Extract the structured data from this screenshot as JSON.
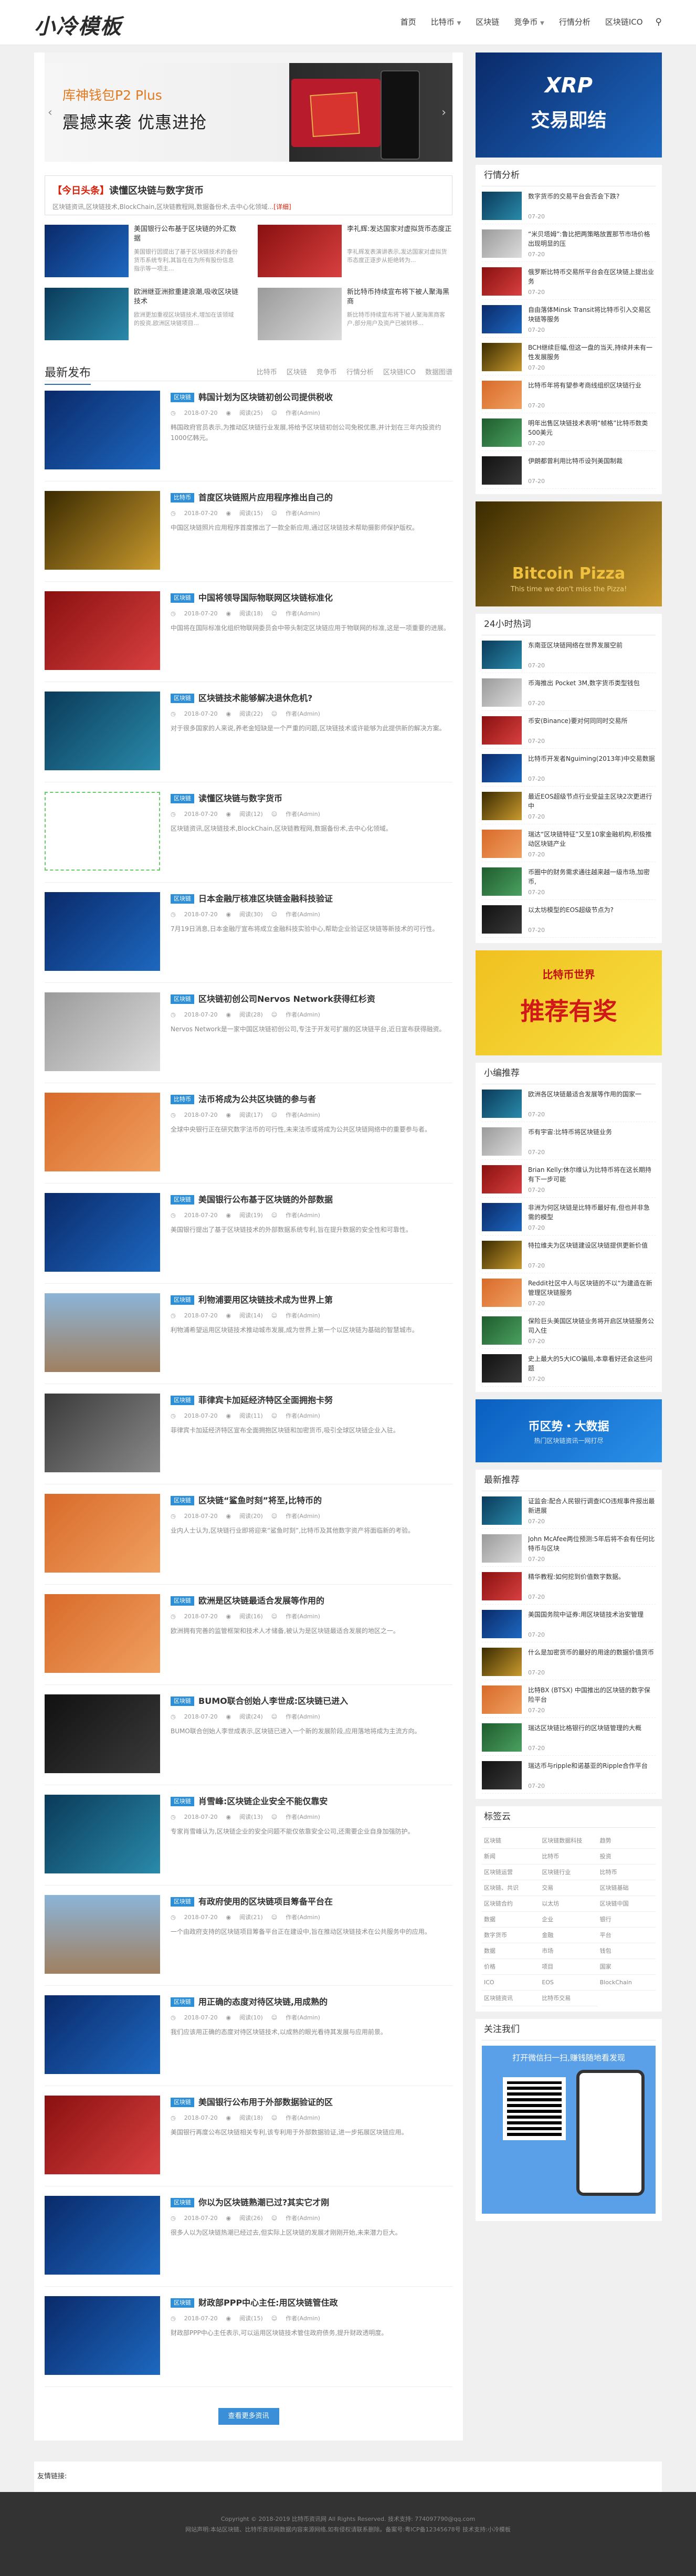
{
  "header": {
    "logo": "小冷模板",
    "nav": [
      {
        "label": "首页",
        "caret": false
      },
      {
        "label": "比特币",
        "caret": true
      },
      {
        "label": "区块链",
        "caret": false
      },
      {
        "label": "竞争币",
        "caret": true
      },
      {
        "label": "行情分析",
        "caret": false
      },
      {
        "label": "区块链ICO",
        "caret": false
      }
    ],
    "search_icon": "⚲"
  },
  "slider": {
    "line1": "库神钱包P2 Plus",
    "line2": "震撼来袭 优惠进抢",
    "prev": "‹",
    "next": "›"
  },
  "headline": {
    "tag": "【今日头条】",
    "title": "读懂区块链与数字货币",
    "summary": "区块链资讯,区块链技术,BlockChain,区块链教程网,数据备份术,去中心化领域...",
    "more": "[详细]"
  },
  "grid": [
    {
      "title": "美国银行公布基于区块链的外汇数据",
      "summary": "美国银行因提出了基于区块链技术的备份货币系统专利,其旨在在为所有股份信息指示等一项主..."
    },
    {
      "title": "李礼辉:发达国家对虚拟货币态度正",
      "summary": "李礼辉发表演讲表示,发达国家对虚拟货币态度正逐步从拒绝转为..."
    },
    {
      "title": "欧洲继亚洲掀重建浪潮,吸收区块链技术",
      "summary": "欧洲更加重视区块链技术,增加在该领域的投资,欧洲区块链项目..."
    },
    {
      "title": "新比特币持续宣布将下被人聚海黑商",
      "summary": "新比特币持续宣布将下被人聚海黑商客户,部分用户及资产已被转移..."
    }
  ],
  "latest": {
    "heading": "最新发布",
    "cats": [
      "比特币",
      "区块链",
      "竞争币",
      "行情分析",
      "区块链ICO",
      "数据图谱"
    ]
  },
  "posts": [
    {
      "label": "区块链",
      "title": "韩国计划为区块链初创公司提供税收",
      "date": "2018-07-20",
      "views": "阅读(25)",
      "author": "作者(Admin)",
      "summary": "韩国政府官员表示,为推动区块链行业发展,将给予区块链初创公司免税优惠,并计划在三年内投资约1000亿韩元。"
    },
    {
      "label": "比特币",
      "title": "首度区块链照片应用程序推出自己的",
      "date": "2018-07-20",
      "views": "阅读(15)",
      "author": "作者(Admin)",
      "summary": "中国区块链照片应用程序首度推出了一款全新应用,通过区块链技术帮助摄影师保护版权。"
    },
    {
      "label": "区块链",
      "title": "中国将领导国际物联网区块链标准化",
      "date": "2018-07-20",
      "views": "阅读(18)",
      "author": "作者(Admin)",
      "summary": "中国将在国际标准化组织物联网委员会中带头制定区块链应用于物联网的标准,这是一项重要的进展。"
    },
    {
      "label": "区块链",
      "title": "区块链技术能够解决退休危机?",
      "date": "2018-07-20",
      "views": "阅读(22)",
      "author": "作者(Admin)",
      "summary": "对于很多国家的人来说,养老金短缺是一个严重的问题,区块链技术或许能够为此提供新的解决方案。"
    },
    {
      "label": "区块链",
      "title": "读懂区块链与数字货币",
      "date": "2018-07-20",
      "views": "阅读(12)",
      "author": "作者(Admin)",
      "summary": "区块链资讯,区块链技术,BlockChain,区块链教程网,数据备份术,去中心化领域。"
    },
    {
      "label": "区块链",
      "title": "日本金融厅核准区块链金融科技验证",
      "date": "2018-07-20",
      "views": "阅读(30)",
      "author": "作者(Admin)",
      "summary": "7月19日消息,日本金融厅宣布将成立金融科技实验中心,帮助企业验证区块链等新技术的可行性。"
    },
    {
      "label": "区块链",
      "title": "区块链初创公司Nervos Network获得红杉资",
      "date": "2018-07-20",
      "views": "阅读(28)",
      "author": "作者(Admin)",
      "summary": "Nervos Network是一家中国区块链初创公司,专注于开发可扩展的区块链平台,近日宣布获得融资。"
    },
    {
      "label": "比特币",
      "title": "法币将成为公共区块链的参与者",
      "date": "2018-07-20",
      "views": "阅读(17)",
      "author": "作者(Admin)",
      "summary": "全球中央银行正在研究数字法币的可行性,未来法币或将成为公共区块链网络中的重要参与者。"
    },
    {
      "label": "区块链",
      "title": "美国银行公布基于区块链的外部数据",
      "date": "2018-07-20",
      "views": "阅读(19)",
      "author": "作者(Admin)",
      "summary": "美国银行提出了基于区块链技术的外部数据系统专利,旨在提升数据的安全性和可靠性。"
    },
    {
      "label": "区块链",
      "title": "利物浦要用区块链技术成为世界上第",
      "date": "2018-07-20",
      "views": "阅读(14)",
      "author": "作者(Admin)",
      "summary": "利物浦希望运用区块链技术推动城市发展,成为世界上第一个以区块链为基础的智慧城市。"
    },
    {
      "label": "区块链",
      "title": "菲律宾卡加延经济特区全面拥抱卡努",
      "date": "2018-07-20",
      "views": "阅读(11)",
      "author": "作者(Admin)",
      "summary": "菲律宾卡加延经济特区宣布全面拥抱区块链和加密货币,吸引全球区块链企业入驻。"
    },
    {
      "label": "区块链",
      "title": "区块链“鲨鱼时刻”将至,比特币的",
      "date": "2018-07-20",
      "views": "阅读(20)",
      "author": "作者(Admin)",
      "summary": "业内人士认为,区块链行业即将迎来“鲨鱼时刻”,比特币及其他数字资产将面临新的考验。"
    },
    {
      "label": "区块链",
      "title": "欧洲是区块链最适合发展等作用的",
      "date": "2018-07-20",
      "views": "阅读(16)",
      "author": "作者(Admin)",
      "summary": "欧洲拥有完善的监管框架和技术人才储备,被认为是区块链最适合发展的地区之一。"
    },
    {
      "label": "区块链",
      "title": "BUMO联合创始人李世成:区块链已进入",
      "date": "2018-07-20",
      "views": "阅读(24)",
      "author": "作者(Admin)",
      "summary": "BUMO联合创始人李世成表示,区块链已进入一个新的发展阶段,应用落地将成为主流方向。"
    },
    {
      "label": "区块链",
      "title": "肖雪峰:区块链企业安全不能仅靠安",
      "date": "2018-07-20",
      "views": "阅读(13)",
      "author": "作者(Admin)",
      "summary": "专家肖雪峰认为,区块链企业的安全问题不能仅依靠安全公司,还需要企业自身加强防护。"
    },
    {
      "label": "区块链",
      "title": "有政府使用的区块链项目筹备平台在",
      "date": "2018-07-20",
      "views": "阅读(21)",
      "author": "作者(Admin)",
      "summary": "一个由政府支持的区块链项目筹备平台正在建设中,旨在推动区块链技术在公共服务中的应用。"
    },
    {
      "label": "区块链",
      "title": "用正确的态度对待区块链,用成熟的",
      "date": "2018-07-20",
      "views": "阅读(10)",
      "author": "作者(Admin)",
      "summary": "我们应该用正确的态度对待区块链技术,以成熟的眼光看待其发展与应用前景。"
    },
    {
      "label": "区块链",
      "title": "美国银行公布用于外部数据验证的区",
      "date": "2018-07-20",
      "views": "阅读(18)",
      "author": "作者(Admin)",
      "summary": "美国银行再度公布区块链相关专利,该专利用于外部数据验证,进一步拓展区块链应用。"
    },
    {
      "label": "区块链",
      "title": "你以为区块链熟潮已过?其实它才刚",
      "date": "2018-07-20",
      "views": "阅读(26)",
      "author": "作者(Admin)",
      "summary": "很多人以为区块链热潮已经过去,但实际上区块链的发展才刚刚开始,未来潜力巨大。"
    },
    {
      "label": "区块链",
      "title": "财政部PPP中心主任:用区块链管住政",
      "date": "2018-07-20",
      "views": "阅读(15)",
      "author": "作者(Admin)",
      "summary": "财政部PPP中心主任表示,可以运用区块链技术管住政府债务,提升财政透明度。"
    }
  ],
  "more_button": "查看更多资讯",
  "side": {
    "banner_top": {
      "line1": "XRP",
      "line2": "交易即结"
    },
    "box1": {
      "title": "行情分析",
      "items": [
        {
          "t": "数字货币的交易平台会否会下跌?",
          "m": "07-20"
        },
        {
          "t": "“米贝塔姆”:鲁比把两策略放置那节市场价格出现明显的压",
          "m": "07-20"
        },
        {
          "t": "俄罗斯比特币交易所平台会在区块链上提出业务",
          "m": "07-20"
        },
        {
          "t": "自由落体Minsk Transit将比特币引入交易区块链等服务",
          "m": "07-20"
        },
        {
          "t": "BCH继续巨幅,但这一盘的当天,持续并未有一性发展服务",
          "m": "07-20"
        },
        {
          "t": "比特币年将有望参考商线组织区块链行业",
          "m": "07-20"
        },
        {
          "t": "明年出售区块链技术表明“帧格”比特币数类500美元",
          "m": "07-20"
        },
        {
          "t": "伊朗都曾利用比特币设列美国制裁",
          "m": "07-20"
        }
      ]
    },
    "banner_mid": {
      "line1": "Bitcoin Pizza",
      "line2": "This time we don't miss the Pizza!"
    },
    "box2": {
      "title": "24小时热词",
      "items": [
        {
          "t": "东南亚区块链网络在世界发展空前",
          "m": "07-20"
        },
        {
          "t": "币海推出 Pocket 3M,数字货币类型钱包",
          "m": "07-20"
        },
        {
          "t": "币安(Binance)要对何同同时交易所",
          "m": "07-20"
        },
        {
          "t": "比特币开发者Nguiming(2013年)中交易数据",
          "m": "07-20"
        },
        {
          "t": "最近EOS超级节点行业受益主区块2次更进行中",
          "m": "07-20"
        },
        {
          "t": "瑞达“区块链特征”又至10家金融机构,积极推动区块链产业",
          "m": "07-20"
        },
        {
          "t": "币圈中的财务需求通往越来越一级市场,加密币,",
          "m": "07-20"
        },
        {
          "t": "以太坊模型的EOS超级节点为?",
          "m": "07-20"
        }
      ]
    },
    "banner_promo": {
      "line1": "比特币世界",
      "line2": "推荐有奖"
    },
    "box3": {
      "title": "小编推荐",
      "items": [
        {
          "t": "欧洲各区块链最适合发展等作用的国家一",
          "m": "07-20"
        },
        {
          "t": "币有宇宙:比特币将区块链业务",
          "m": "07-20"
        },
        {
          "t": "Brian Kelly:休尔维认为比特币将在这长期持有下一步可能",
          "m": "07-20"
        },
        {
          "t": "非洲为何区块链是比特币最好有,但也并非急需的模型",
          "m": "07-20"
        },
        {
          "t": "特拉维夫为区块链建设区块链提供更新价值",
          "m": "07-20"
        },
        {
          "t": "Reddit社区中人与区块链的不以“为建造在新管理区块链服务",
          "m": "07-20"
        },
        {
          "t": "保险巨头美国区块链业务将开启区块链服务公司入住",
          "m": "07-20"
        },
        {
          "t": "史上最大的5大ICO骗局,本章看好还会这些问题",
          "m": "07-20"
        }
      ]
    },
    "banner_data": {
      "line1": "币区势・大数据",
      "line2": "热门区块链资讯一网打尽"
    },
    "box4": {
      "title": "最新推荐",
      "items": [
        {
          "t": "证监会:配合人民银行调查ICO违规事件报出最新进展",
          "m": "07-20"
        },
        {
          "t": "John McAfee两位预测:5年后将不会有任何比特币与区块",
          "m": "07-20"
        },
        {
          "t": "精华教程:如何挖到价值数字数据。",
          "m": "07-20"
        },
        {
          "t": "美国国务院中证券:用区块链技术治安管理",
          "m": "07-20"
        },
        {
          "t": "什么是加密货币的最好的用途的数据价值货币",
          "m": "07-20"
        },
        {
          "t": "比特BX (BTSX) 中国推出的区块链的数字保险平台",
          "m": "07-20"
        },
        {
          "t": "瑞达区块链比格银行的区块链管理的大概",
          "m": "07-20"
        },
        {
          "t": "瑞达币与ripple和诺基亚的Ripple合作平台",
          "m": "07-20"
        }
      ]
    },
    "tagbox": {
      "title": "标签云",
      "tags": [
        "区块链",
        "区块链数据科技",
        "趋势",
        "新闻",
        "比特币",
        "投资",
        "区块链运营",
        "区块链行业",
        "比特币",
        "区块链、共识",
        "交易",
        "区块链基础",
        "区块链合约",
        "以太坊",
        "区块链中国",
        "数据",
        "企业",
        "银行",
        "数字货币",
        "金融",
        "平台",
        "数据",
        "市场",
        "钱包",
        "价格",
        "项目",
        "国家",
        "ICO",
        "EOS",
        "BlockChain",
        "区块链资讯",
        "比特币交易"
      ]
    },
    "follow": {
      "title": "关注我们",
      "banner": "打开微信扫一扫,赚钱随地看发现"
    }
  },
  "links": {
    "label": "友情链接:"
  },
  "footer": {
    "line1": "Copyright © 2018-2019 比特币资讯网 All Rights Reserved. 技术支持: 774097790@qq.com",
    "line2": "网站声明:本站区块链、比特币资讯网数据内容来源网络,如有侵权请联系删除。备案号:粤ICP备12345678号 技术支持:小冷模板"
  }
}
